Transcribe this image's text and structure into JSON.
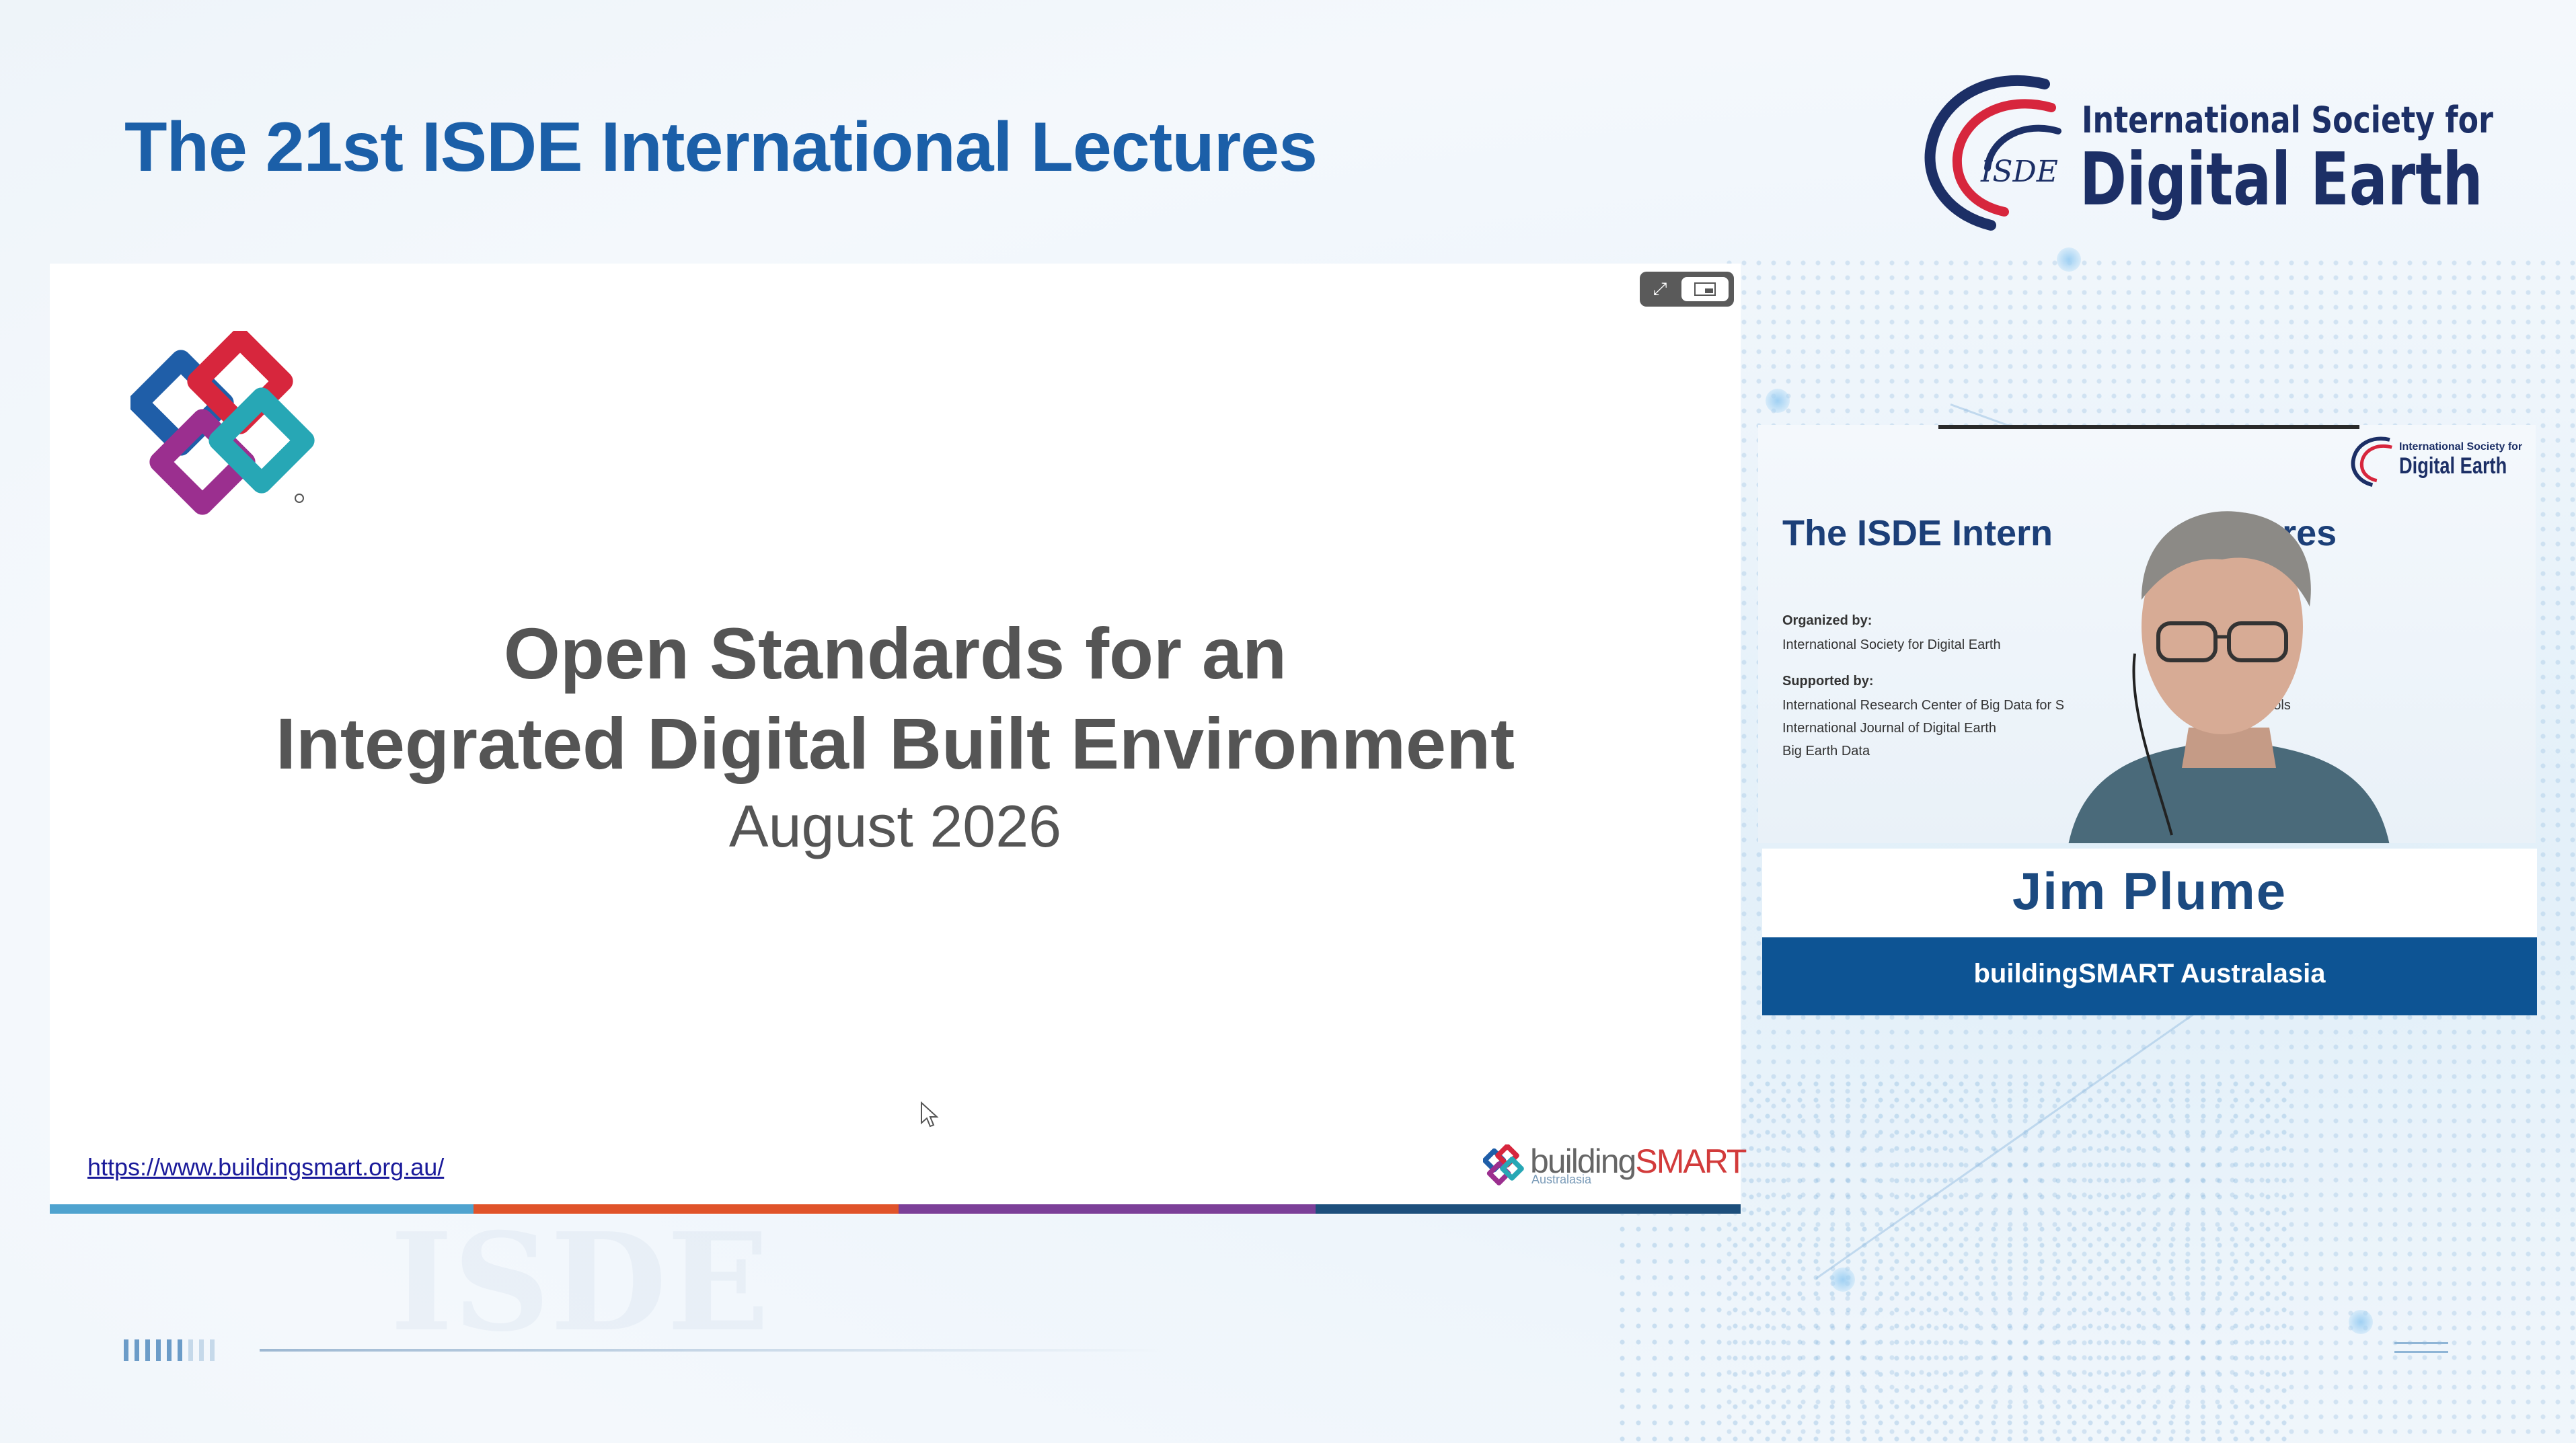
{
  "header": {
    "title": "The 21st ISDE International Lectures",
    "logo_line1": "International Society for",
    "logo_line2": "Digital Earth",
    "logo_mark": "ISDE"
  },
  "slide": {
    "title_line1": "Open Standards for an",
    "title_line2": "Integrated Digital Built Environment",
    "date": "August 2026",
    "url": "https://www.buildingsmart.org.au/",
    "brand_building": "building",
    "brand_smart": "SMART",
    "brand_sub": "Australasia",
    "color_bars": [
      "#4fa3cf",
      "#e0532a",
      "#7b3f98",
      "#1d4f7c"
    ]
  },
  "speaker_video": {
    "inner_title_left": "The ISDE Intern",
    "inner_title_right": "ectures",
    "organized_label": "Organized by:",
    "organized_value": "International Society for Digital Earth",
    "supported_label": "Supported by:",
    "supported_1_left": "International Research Center of Big Data for S",
    "supported_1_right": "ools",
    "supported_2": "International Journal of Digital Earth",
    "supported_3": "Big Earth Data",
    "mini_logo_line1": "International Society for",
    "mini_logo_line2": "Digital Earth"
  },
  "speaker": {
    "name": "Jim Plume",
    "organization": "buildingSMART Australasia"
  },
  "colors": {
    "title_blue": "#1b5fa8",
    "org_bar": "#0d5494",
    "name_color": "#1c4a80"
  }
}
